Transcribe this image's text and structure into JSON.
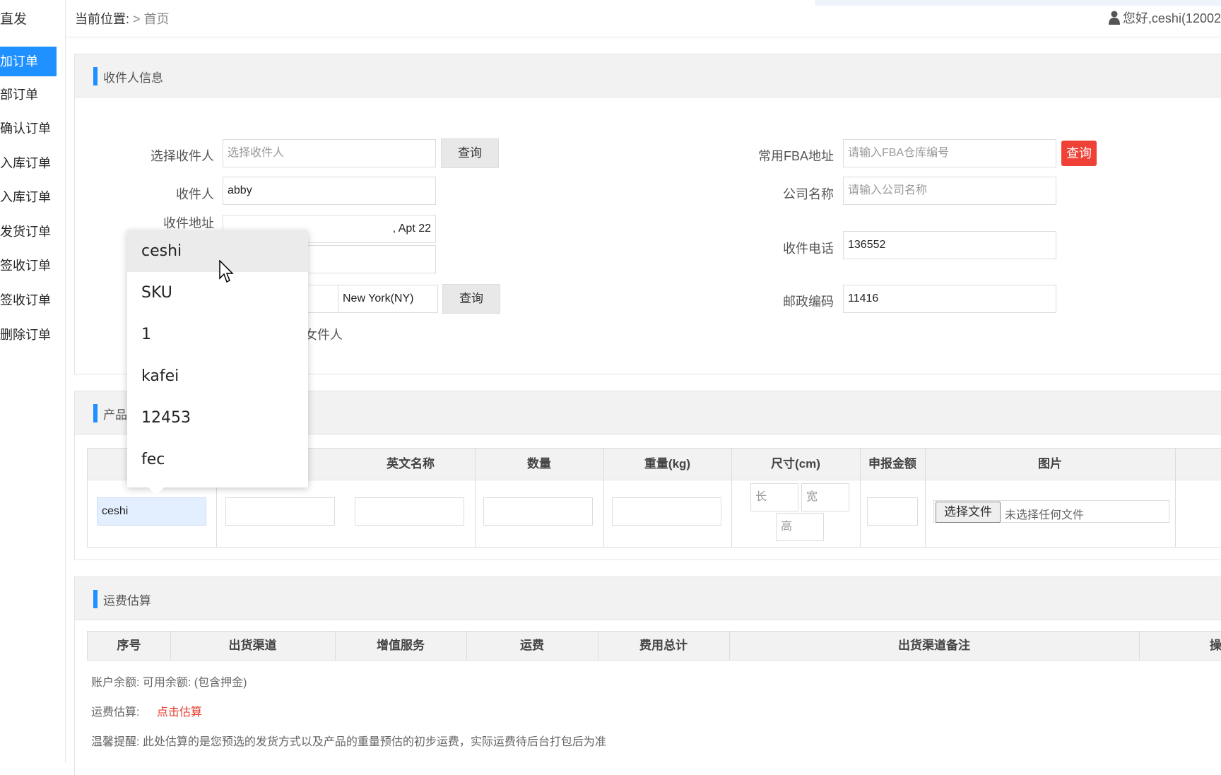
{
  "sidebar": {
    "brand": "直发",
    "items": [
      "加订单",
      "部订单",
      "确认订单",
      "入库订单",
      "入库订单",
      "发货订单",
      "签收订单",
      "签收订单",
      "删除订单"
    ]
  },
  "topbar": {
    "location_label": "当前位置:",
    "separator": ">",
    "home": "首页",
    "greeting": "您好,ceshi(12002"
  },
  "recipient": {
    "title": "收件人信息",
    "select_label": "选择收件人",
    "select_placeholder": "选择收件人",
    "query1": "查询",
    "name_label": "收件人",
    "name_value": "abby",
    "address_label": "收件地址",
    "address_value": ", Apt 22",
    "state_value": "New York(NY)",
    "query2": "查询",
    "partial_text": "女件人",
    "fba_label": "常用FBA地址",
    "fba_placeholder": "请输入FBA仓库编号",
    "fba_query": "查询",
    "company_label": "公司名称",
    "company_placeholder": "请输入公司名称",
    "phone_label": "收件电话",
    "phone_value": "136552",
    "zip_label": "邮政编码",
    "zip_value": "11416"
  },
  "product": {
    "title": "产品",
    "headers": {
      "en_name": "英文名称",
      "qty": "数量",
      "weight": "重量(kg)",
      "size": "尺寸(cm)",
      "declared": "申报金额",
      "image": "图片"
    },
    "row": {
      "sku_value": "ceshi",
      "length_ph": "长",
      "width_ph": "宽",
      "height_ph": "高",
      "choose_file": "选择文件",
      "no_file": "未选择任何文件"
    }
  },
  "dropdown": {
    "options": [
      "ceshi",
      "SKU",
      "1",
      "kafei",
      "12453",
      "fec"
    ]
  },
  "freight": {
    "title": "运费估算",
    "headers": [
      "序号",
      "出货渠道",
      "增值服务",
      "运费",
      "费用总计",
      "出货渠道备注",
      "操"
    ],
    "balance": "账户余额: 可用余额: (包含押金)",
    "estimate_label": "运费估算:",
    "estimate_link": "点击估算",
    "tip": "温馨提醒: 此处估算的是您预选的发货方式以及产品的重量预估的初步运费，实际运费待后台打包后为准"
  },
  "colors": {
    "accent": "#1e90ff",
    "danger": "#ef4136",
    "link_red": "#e43d30"
  }
}
